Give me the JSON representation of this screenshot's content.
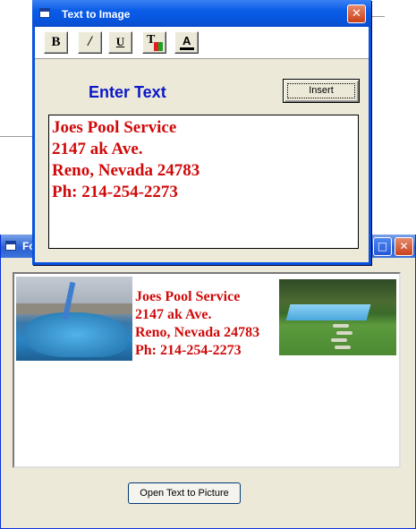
{
  "back_window": {
    "title": "Fo",
    "open_button_label": "Open Text to Picture",
    "max_glyph": "□",
    "close_glyph": "✕",
    "address_lines": [
      "Joes Pool Service",
      "2147 ak Ave.",
      "Reno, Nevada 24783",
      "Ph: 214-254-2273"
    ]
  },
  "dialog": {
    "title": "Text to Image",
    "close_glyph": "✕",
    "toolbar": {
      "bold": "B",
      "italic": "/",
      "underline": "U",
      "font": "T",
      "color": "A"
    },
    "enter_label": "Enter Text",
    "insert_label": "Insert",
    "text_content": "Joes Pool Service\n2147 ak Ave.\nReno, Nevada 24783\nPh: 214-254-2273"
  },
  "colors": {
    "text_red": "#d00a0a",
    "label_blue": "#0a18c8",
    "title_blue": "#0a5ce8"
  }
}
